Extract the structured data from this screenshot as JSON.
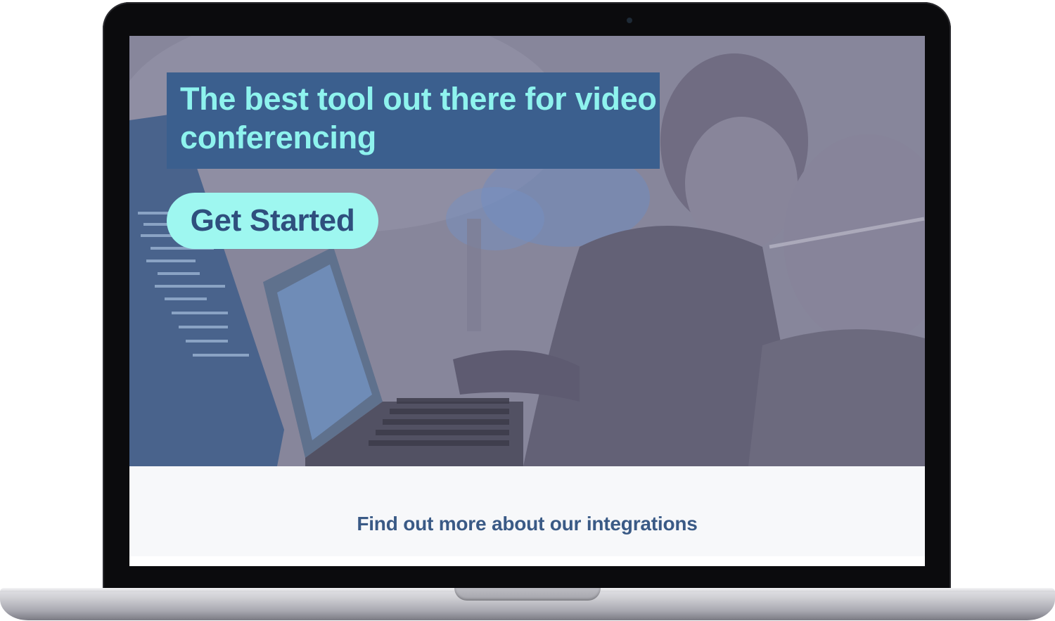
{
  "hero": {
    "headline": "The best tool out there for video conferencing",
    "cta_label": "Get Started"
  },
  "lower": {
    "integrations_link": "Find out more about our integrations"
  },
  "colors": {
    "headline_box": "#3b5f8e",
    "headline_text": "#8ef3ee",
    "cta_bg": "#9ef7f0",
    "cta_text": "#2f4f7e",
    "link_text": "#3a5a86",
    "hero_tint": "#7a7890"
  }
}
